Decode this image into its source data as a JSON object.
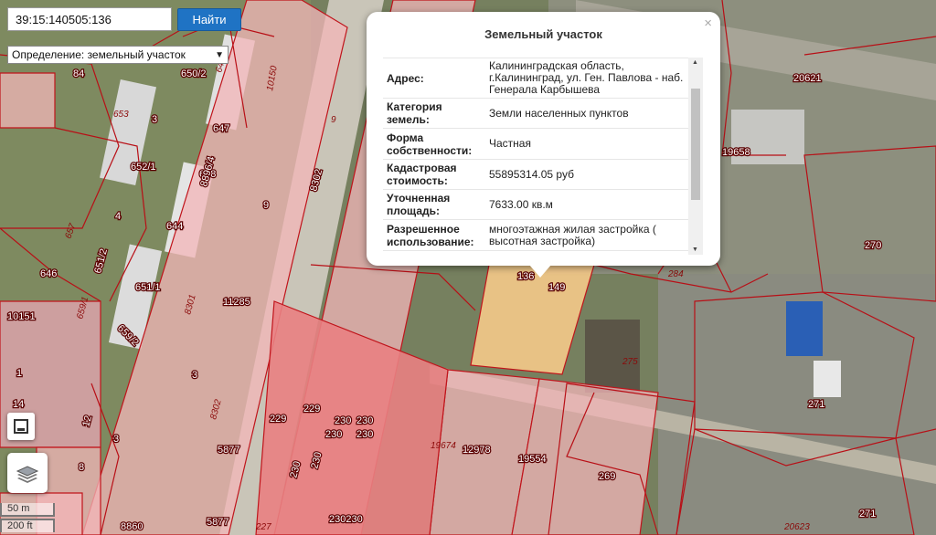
{
  "search": {
    "value": "39:15:140505:136",
    "button_label": "Найти"
  },
  "definition": {
    "label": "Определение:",
    "selected": "земельный участок"
  },
  "popup": {
    "title": "Земельный участок",
    "close": "×",
    "rows": [
      {
        "key": "Адрес:",
        "value": "Калининградская область, г.Калининград, ул. Ген. Павлова - наб. Генерала Карбышева"
      },
      {
        "key": "Категория земель:",
        "value": "Земли населенных пунктов"
      },
      {
        "key": "Форма собственности:",
        "value": "Частная"
      },
      {
        "key": "Кадастровая стоимость:",
        "value": "55895314.05 руб"
      },
      {
        "key": "Уточненная площадь:",
        "value": "7633.00 кв.м"
      },
      {
        "key": "Разрешенное использование:",
        "value": "многоэтажная жилая застройка ( высотная застройка)"
      }
    ]
  },
  "scale": {
    "metric": "50 m",
    "imperial": "200 ft"
  },
  "icons": {
    "print": "print-icon",
    "layers": "layers-icon",
    "close": "close-icon"
  },
  "colors": {
    "parcel_fill": "#f3b6b8",
    "parcel_stroke": "#c0141b",
    "selected_parcel": "#f5c98a",
    "button": "#1f73c4"
  },
  "map_labels": [
    "84",
    "650/2",
    "649",
    "653",
    "3",
    "647",
    "652/1",
    "648",
    "644",
    "657",
    "4",
    "651/2",
    "646",
    "651/1",
    "659/1",
    "10151",
    "659/2",
    "1",
    "14",
    "12",
    "3",
    "8",
    "9",
    "8896/4",
    "8302",
    "9",
    "10150",
    "8301",
    "11285",
    "3",
    "8302",
    "5877",
    "5877",
    "8860",
    "227",
    "229",
    "229",
    "230",
    "230",
    "230",
    "230",
    "230",
    "230",
    "230230",
    "19674",
    "12978",
    "19554",
    "269",
    "136",
    "149",
    "284",
    "275",
    "271",
    "270",
    "19658",
    "20621",
    "20623",
    "271"
  ]
}
